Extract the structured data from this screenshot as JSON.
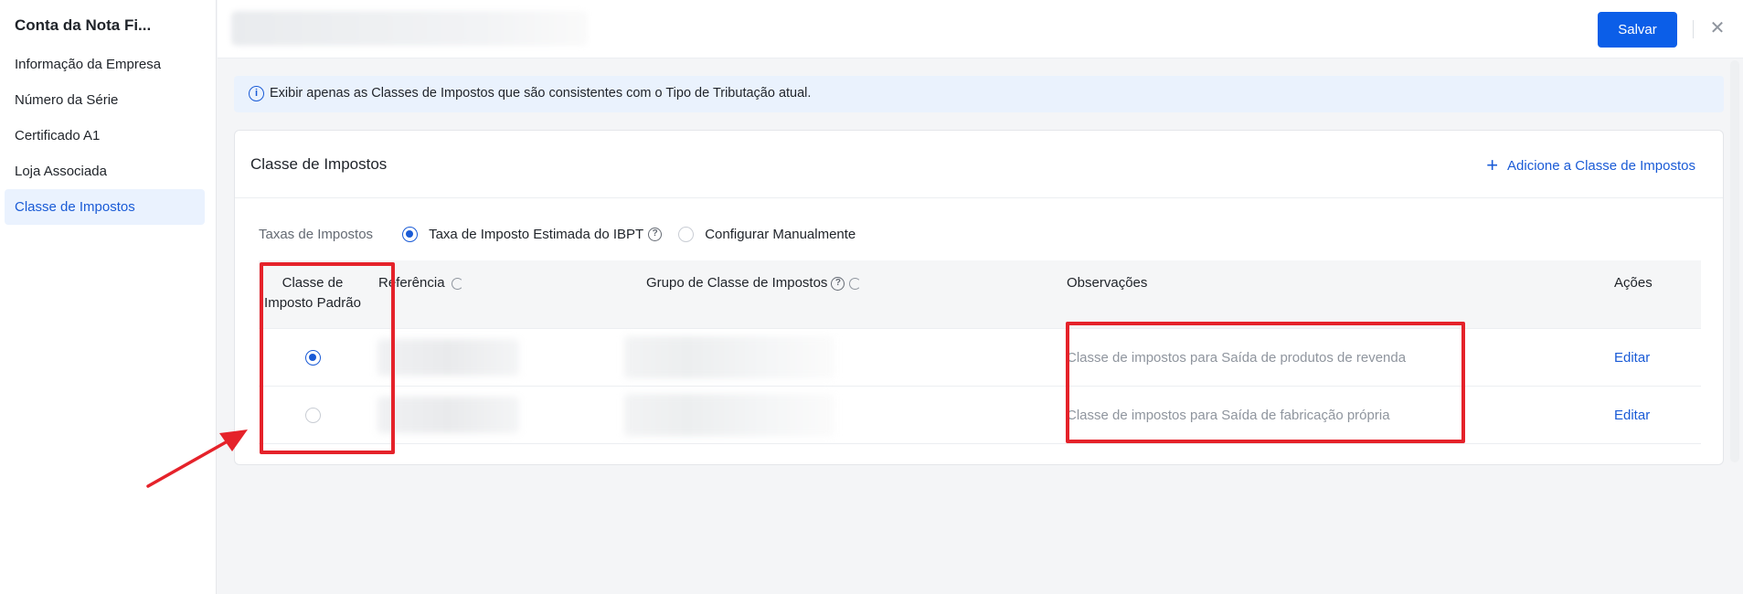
{
  "sidebar": {
    "title": "Conta da Nota Fi...",
    "items": [
      {
        "label": "Informação da Empresa",
        "active": false
      },
      {
        "label": "Número da Série",
        "active": false
      },
      {
        "label": "Certificado A1",
        "active": false
      },
      {
        "label": "Loja Associada",
        "active": false
      },
      {
        "label": "Classe de Impostos",
        "active": true
      }
    ]
  },
  "header": {
    "save_label": "Salvar",
    "close_icon": "close-icon"
  },
  "info_banner": {
    "icon": "info-icon",
    "text": "Exibir apenas as Classes de Impostos que são consistentes com o Tipo de Tributação atual."
  },
  "card": {
    "title": "Classe de Impostos",
    "add_label": "Adicione a Classe de Impostos",
    "rates": {
      "label": "Taxas de Impostos",
      "options": [
        {
          "label": "Taxa de Imposto Estimada do IBPT",
          "selected": true,
          "help": true
        },
        {
          "label": "Configurar Manualmente",
          "selected": false,
          "help": false
        }
      ]
    },
    "table": {
      "columns": {
        "default": "Classe de Imposto Padrão",
        "reference": "Referência",
        "group": "Grupo de Classe de Impostos",
        "observations": "Observações",
        "actions": "Ações"
      },
      "rows": [
        {
          "default": true,
          "observation": "Classe de impostos para Saída de produtos de revenda",
          "action": "Editar"
        },
        {
          "default": false,
          "observation": "Classe de impostos para Saída de fabricação própria",
          "action": "Editar"
        }
      ]
    }
  },
  "colors": {
    "primary": "#0b5ee8",
    "link": "#1a5bd6",
    "annotation": "#e5222a",
    "banner_bg": "#eaf2fd"
  }
}
